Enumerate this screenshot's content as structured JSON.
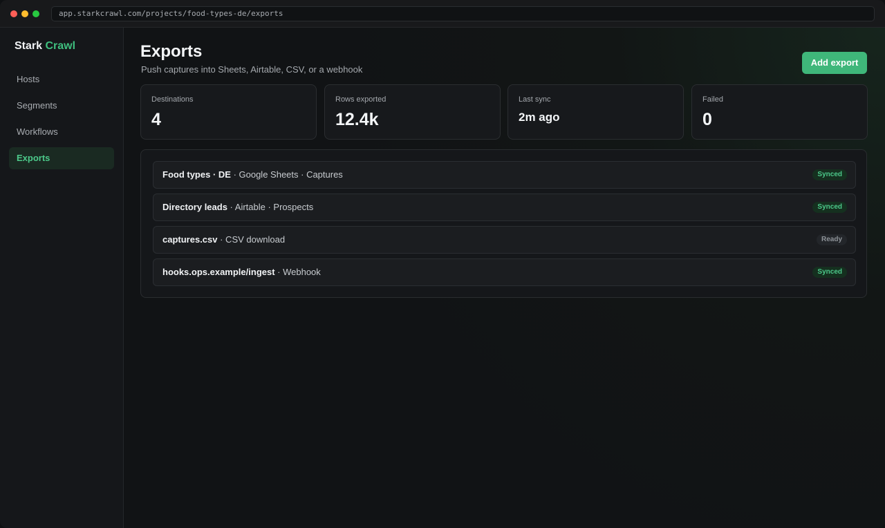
{
  "browser": {
    "url": "app.starkcrawl.com/projects/food-types-de/exports"
  },
  "sidebar": {
    "brand_main": "Stark",
    "brand_accent": "Crawl",
    "items": [
      {
        "label": "Hosts",
        "active": false
      },
      {
        "label": "Segments",
        "active": false
      },
      {
        "label": "Workflows",
        "active": false
      },
      {
        "label": "Exports",
        "active": true
      }
    ]
  },
  "header": {
    "title": "Exports",
    "subtitle": "Push captures into Sheets, Airtable, CSV, or a webhook",
    "add_button": "Add export"
  },
  "stats": [
    {
      "label": "Destinations",
      "value": "4"
    },
    {
      "label": "Rows exported",
      "value": "12.4k"
    },
    {
      "label": "Last sync",
      "value": "2m ago"
    },
    {
      "label": "Failed",
      "value": "0"
    }
  ],
  "exports": [
    {
      "name": "Food types · DE",
      "detail": " · Google Sheets · Captures",
      "status": "Synced"
    },
    {
      "name": "Directory leads",
      "detail": " · Airtable · Prospects",
      "status": "Synced"
    },
    {
      "name": "captures.csv",
      "detail": " · CSV download",
      "status": "Ready"
    },
    {
      "name": "hooks.ops.example/ingest",
      "detail": " · Webhook",
      "status": "Synced"
    }
  ],
  "colors": {
    "accent": "#3fb77a",
    "synced": "#4cc98a",
    "ready": "#8e9398"
  }
}
